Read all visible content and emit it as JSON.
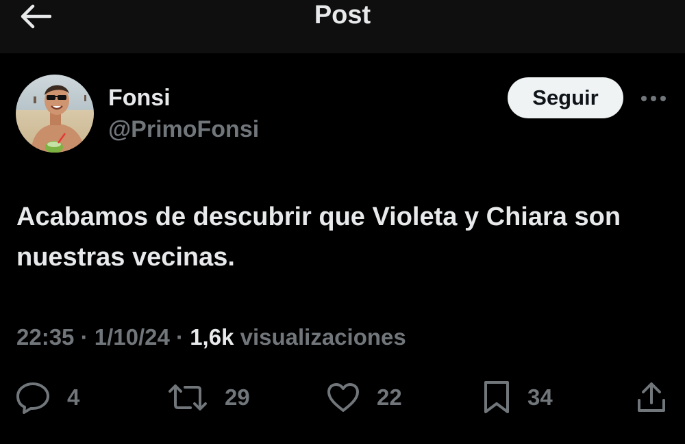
{
  "header": {
    "title": "Post"
  },
  "author": {
    "display_name": "Fonsi",
    "handle": "@PrimoFonsi",
    "follow_label": "Seguir"
  },
  "post": {
    "text": "Acabamos de descubrir que Violeta y Chiara son nuestras vecinas."
  },
  "meta": {
    "time": "22:35",
    "date": "1/10/24",
    "views_count": "1,6k",
    "views_label": "visualizaciones",
    "separator": "·"
  },
  "actions": {
    "replies": "4",
    "reposts": "29",
    "likes": "22",
    "bookmarks": "34"
  },
  "colors": {
    "background": "#000000",
    "header_background": "#0f0f0f",
    "primary_text": "#e7e9ea",
    "secondary_text": "#71767b",
    "follow_button_bg": "#eff3f4"
  },
  "icons": {
    "back": "arrow-left-icon",
    "more": "more-horizontal-icon",
    "reply": "reply-icon",
    "repost": "repost-icon",
    "like": "heart-icon",
    "bookmark": "bookmark-icon",
    "share": "share-icon"
  }
}
